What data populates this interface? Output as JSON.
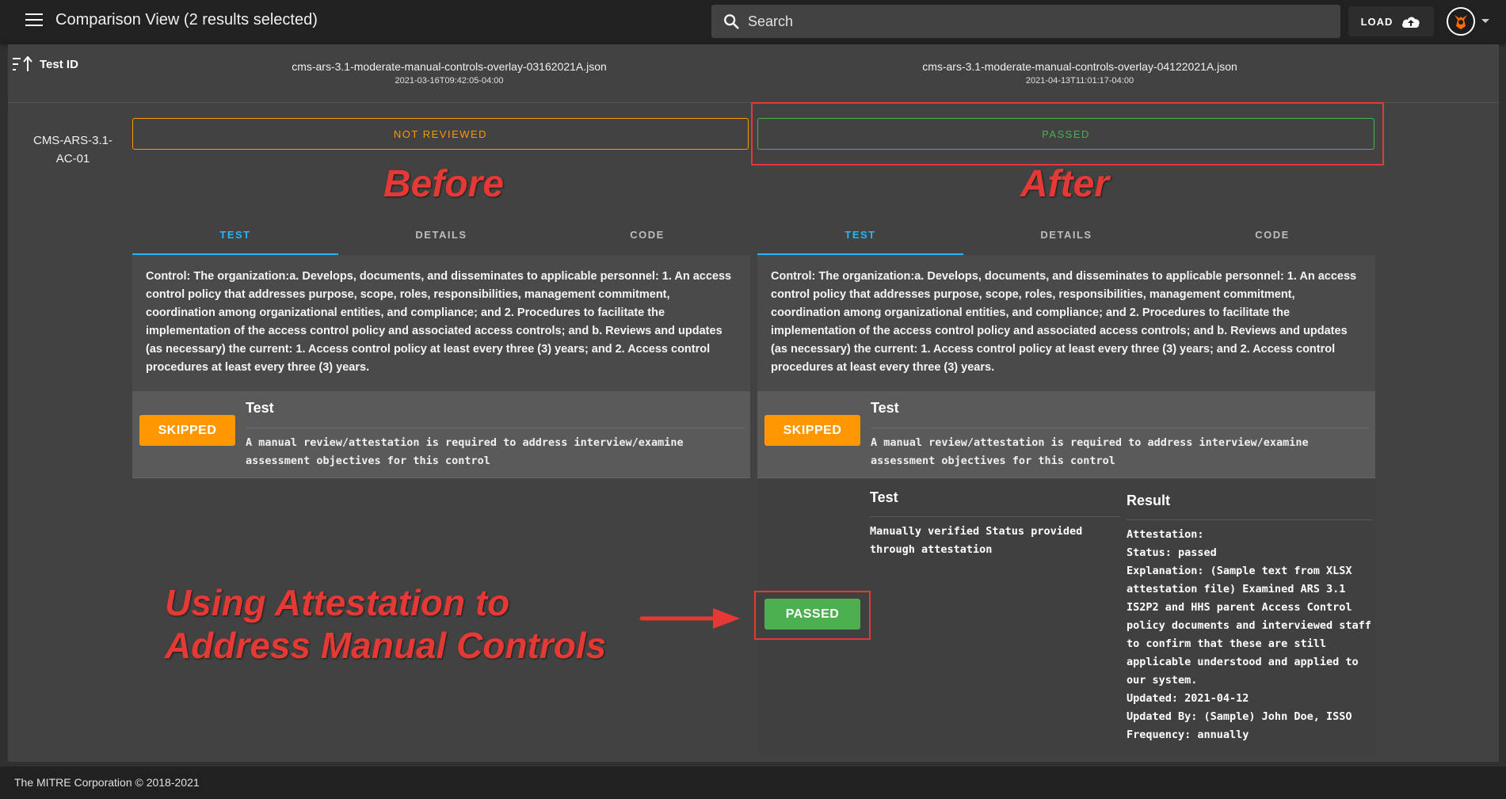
{
  "topbar": {
    "title": "Comparison View (2 results selected)",
    "search_placeholder": "Search",
    "load_label": "LOAD"
  },
  "header": {
    "testid_label": "Test ID",
    "files": [
      {
        "name": "cms-ars-3.1-moderate-manual-controls-overlay-03162021A.json",
        "date": "2021-03-16T09:42:05-04:00"
      },
      {
        "name": "cms-ars-3.1-moderate-manual-controls-overlay-04122021A.json",
        "date": "2021-04-13T11:01:17-04:00"
      }
    ]
  },
  "control": {
    "id": "CMS-ARS-3.1-AC-01",
    "statuses": [
      "NOT REVIEWED",
      "PASSED"
    ]
  },
  "annotations": {
    "before": "Before",
    "after": "After",
    "line1": "Using Attestation to",
    "line2": "Address Manual Controls"
  },
  "tabs": [
    "TEST",
    "DETAILS",
    "CODE"
  ],
  "description": "Control: The organization:a. Develops, documents, and disseminates to applicable personnel: 1. An access control policy that addresses purpose, scope, roles, responsibilities, management commitment, coordination among organizational entities, and compliance; and 2. Procedures to facilitate the implementation of the access control policy and associated access controls; and b. Reviews and updates (as necessary) the current: 1. Access control policy at least every three (3) years; and 2. Access control procedures at least every three (3) years.",
  "result": {
    "badge": "SKIPPED",
    "heading": "Test",
    "text": "A manual review/attestation is required to address interview/examine assessment objectives for this control"
  },
  "attestation": {
    "badge": "PASSED",
    "test_heading": "Test",
    "test_text": "Manually verified Status provided through attestation",
    "result_heading": "Result",
    "result_text": "Attestation:\nStatus: passed\nExplanation: (Sample text from XLSX attestation file) Examined ARS 3.1 IS2P2 and HHS parent Access Control policy documents and interviewed staff to confirm that these are still applicable understood and applied to our system.\nUpdated: 2021-04-12\nUpdated By: (Sample) John Doe, ISSO\nFrequency: annually"
  },
  "footer": "The MITRE Corporation © 2018-2021",
  "colors": {
    "accent": "#29b6f6",
    "orange": "#ff9800",
    "green": "#4caf50",
    "annotation_red": "#e53935"
  }
}
